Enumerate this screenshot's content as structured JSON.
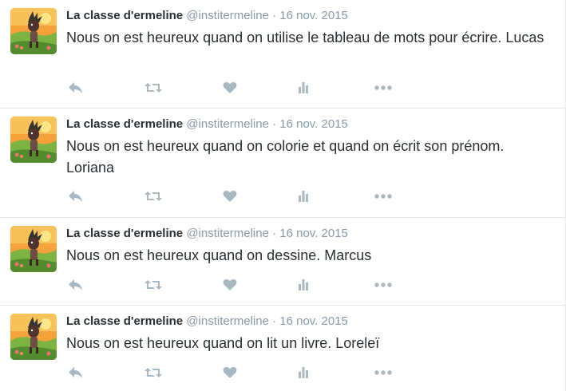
{
  "tweets": [
    {
      "name": "La classe d'ermeline",
      "handle": "@institermeline",
      "separator": "·",
      "date": "16 nov. 2015",
      "text": "Nous on est heureux quand on utilise le tableau de mots pour écrire. Lucas"
    },
    {
      "name": "La classe d'ermeline",
      "handle": "@institermeline",
      "separator": "·",
      "date": "16 nov. 2015",
      "text": "Nous on est heureux quand on colorie et quand on écrit son prénom. Loriana"
    },
    {
      "name": "La classe d'ermeline",
      "handle": "@institermeline",
      "separator": "·",
      "date": "16 nov. 2015",
      "text": "Nous on est heureux quand on dessine. Marcus"
    },
    {
      "name": "La classe d'ermeline",
      "handle": "@institermeline",
      "separator": "·",
      "date": "16 nov. 2015",
      "text": "Nous on est heureux quand on lit un livre. Loreleï"
    }
  ],
  "icons": {
    "reply": "reply-icon",
    "retweet": "retweet-icon",
    "like": "heart-icon",
    "analytics": "analytics-icon",
    "more": "more-icon"
  },
  "colors": {
    "name": "#292f33",
    "meta": "#8899a6",
    "icon": "#aab8c2",
    "border": "#e1e8ed"
  }
}
